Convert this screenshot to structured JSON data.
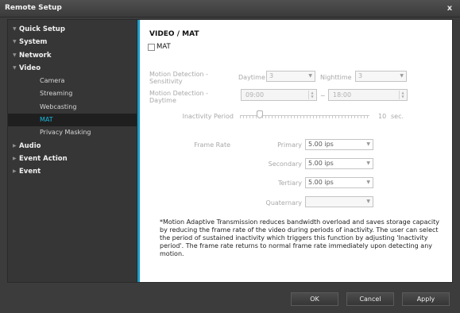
{
  "window": {
    "title": "Remote Setup",
    "close_glyph": "x"
  },
  "sidebar": {
    "items": [
      {
        "label": "Quick Setup",
        "level": 1,
        "arrow": "▼"
      },
      {
        "label": "System",
        "level": 1,
        "arrow": "▼"
      },
      {
        "label": "Network",
        "level": 1,
        "arrow": "▼"
      },
      {
        "label": "Video",
        "level": 1,
        "arrow": "▼"
      },
      {
        "label": "Camera",
        "level": 2
      },
      {
        "label": "Streaming",
        "level": 2
      },
      {
        "label": "Webcasting",
        "level": 2
      },
      {
        "label": "MAT",
        "level": 2,
        "active": true
      },
      {
        "label": "Privacy Masking",
        "level": 2
      },
      {
        "label": "Audio",
        "level": 1,
        "arrow": "▶"
      },
      {
        "label": "Event Action",
        "level": 1,
        "arrow": "▶"
      },
      {
        "label": "Event",
        "level": 1,
        "arrow": "▶"
      }
    ]
  },
  "content": {
    "section_title": "VIDEO / MAT",
    "mat_checkbox": {
      "label": "MAT",
      "checked": false
    },
    "motion_sensitivity": {
      "label": "Motion Detection -\nSensitivity",
      "daytime_label": "Daytime",
      "daytime_value": "3",
      "nighttime_label": "Nighttime",
      "nighttime_value": "3"
    },
    "motion_daytime": {
      "label": "Motion Detection -\nDaytime",
      "start": "09:00",
      "separator": "~",
      "end": "18:00"
    },
    "inactivity": {
      "label": "Inactivity Period",
      "value": "10",
      "unit": "sec.",
      "level_fraction": 0.0
    },
    "frame_rate": {
      "label": "Frame Rate",
      "rows": [
        {
          "label": "Primary",
          "value": "5.00 ips",
          "disabled": false
        },
        {
          "label": "Secondary",
          "value": "5.00 ips",
          "disabled": false
        },
        {
          "label": "Tertiary",
          "value": "5.00 ips",
          "disabled": false
        },
        {
          "label": "Quaternary",
          "value": "",
          "disabled": true
        }
      ]
    },
    "note": "*Motion Adaptive Transmission reduces bandwidth overload and saves storage capacity by reducing the frame rate of the video during periods of inactivity. The user can select the period of sustained inactivity which triggers this function by adjusting 'Inactivity period'. The frame rate returns to normal frame rate immediately upon detecting any motion."
  },
  "buttons": {
    "ok": "OK",
    "cancel": "Cancel",
    "apply": "Apply"
  },
  "colors": {
    "accent": "#1a9fc9",
    "active_text": "#18b8e0",
    "window_bg": "#3c3c3c"
  },
  "icons": {
    "tree_expanded": "triangle-down-icon",
    "tree_collapsed": "triangle-right-icon",
    "select": "chevron-down-icon",
    "close": "close-icon"
  }
}
